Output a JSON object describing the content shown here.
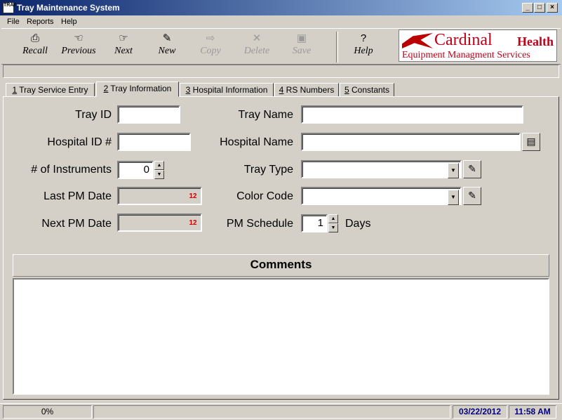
{
  "window": {
    "title": "Tray Maintenance System",
    "app_icon_text": "TRAY"
  },
  "menu": [
    {
      "label": "File"
    },
    {
      "label": "Reports"
    },
    {
      "label": "Help"
    }
  ],
  "toolbar": {
    "buttons": [
      {
        "label": "Recall",
        "icon": "recall-icon",
        "enabled": true
      },
      {
        "label": "Previous",
        "icon": "previous-icon",
        "enabled": true
      },
      {
        "label": "Next",
        "icon": "next-icon",
        "enabled": true
      },
      {
        "label": "New",
        "icon": "new-icon",
        "enabled": true
      },
      {
        "label": "Copy",
        "icon": "copy-icon",
        "enabled": false
      },
      {
        "label": "Delete",
        "icon": "delete-icon",
        "enabled": false
      },
      {
        "label": "Save",
        "icon": "save-icon",
        "enabled": false
      },
      {
        "label": "Help",
        "icon": "help-icon",
        "enabled": true
      }
    ]
  },
  "logo": {
    "brand": "Cardinal",
    "brand2": "Health",
    "subtitle": "Equipment Managment Services",
    "color": "#c00018"
  },
  "tabs": [
    {
      "num": "1",
      "label": " Tray Service Entry"
    },
    {
      "num": "2",
      "label": " Tray Information"
    },
    {
      "num": "3",
      "label": " Hospital Information"
    },
    {
      "num": "4",
      "label": " RS Numbers"
    },
    {
      "num": "5",
      "label": " Constants"
    }
  ],
  "active_tab_index": 1,
  "form": {
    "tray_id": {
      "label": "Tray ID",
      "value": ""
    },
    "tray_name": {
      "label": "Tray Name",
      "value": ""
    },
    "hospital_id": {
      "label": "Hospital ID #",
      "value": ""
    },
    "hospital_name": {
      "label": "Hospital Name",
      "value": ""
    },
    "num_instruments": {
      "label": "# of Instruments",
      "value": "0"
    },
    "tray_type": {
      "label": "Tray Type",
      "value": ""
    },
    "last_pm_date": {
      "label": "Last PM Date",
      "value": ""
    },
    "color_code": {
      "label": "Color Code",
      "value": ""
    },
    "next_pm_date": {
      "label": "Next PM Date",
      "value": ""
    },
    "pm_schedule": {
      "label": "PM Schedule",
      "value": "1",
      "unit": "Days"
    },
    "calendar_glyph": "12"
  },
  "comments": {
    "header": "Comments",
    "value": ""
  },
  "statusbar": {
    "progress": "0%",
    "date": "03/22/2012",
    "time": "11:58 AM"
  }
}
